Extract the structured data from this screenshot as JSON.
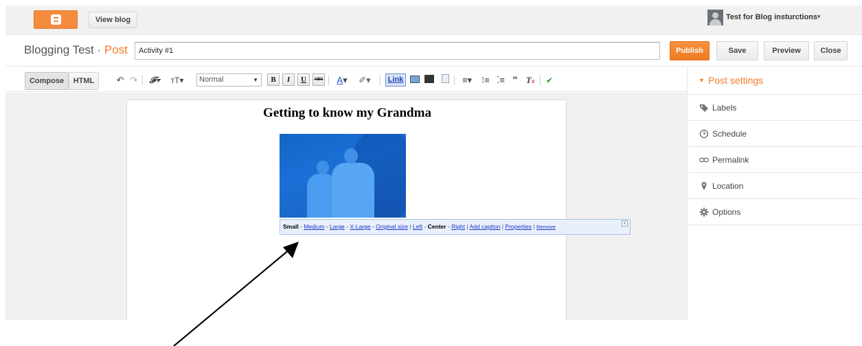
{
  "topbar": {
    "view_blog": "View blog",
    "account_name": "Test for Blog insturctions",
    "account_caret": "▾"
  },
  "titlebar": {
    "blog_name": "Blogging Test · ",
    "post_word": "Post",
    "post_title_value": "Activity #1",
    "publish": "Publish",
    "save": "Save",
    "preview": "Preview",
    "close": "Close"
  },
  "toolbar": {
    "compose": "Compose",
    "html": "HTML",
    "font_size": "Normal",
    "bold": "B",
    "italic": "I",
    "underline": "U",
    "strike": "ABC",
    "link": "Link",
    "icons": [
      "undo-icon",
      "redo-icon",
      "font-family-icon",
      "font-size-icon",
      "text-color-icon",
      "highlight-icon",
      "insert-image-icon",
      "insert-video-icon",
      "jump-break-icon",
      "align-icon",
      "numbered-list-icon",
      "bullet-list-icon",
      "quote-icon",
      "clear-format-icon",
      "spellcheck-icon"
    ]
  },
  "editor": {
    "post_heading": "Getting to know my Grandma",
    "image_toolbar": {
      "small": "Small",
      "medium": "Medium",
      "large": "Large",
      "xlarge": "X-Large",
      "original": "Original size",
      "left": "Left",
      "center": "Center",
      "right": "Right",
      "caption": "Add caption",
      "properties": "Properties",
      "remove": "Remove",
      "dash": " - ",
      "bar": " | "
    }
  },
  "sidebar": {
    "title": "Post settings",
    "items": [
      {
        "label": "Labels",
        "icon": "tag-icon"
      },
      {
        "label": "Schedule",
        "icon": "clock-icon"
      },
      {
        "label": "Permalink",
        "icon": "link-icon"
      },
      {
        "label": "Location",
        "icon": "location-pin-icon"
      },
      {
        "label": "Options",
        "icon": "gear-icon"
      }
    ]
  },
  "colors": {
    "accent_orange": "#f57b29",
    "link_blue": "#1a35c8",
    "photo_blue": "#1b6fd6"
  }
}
